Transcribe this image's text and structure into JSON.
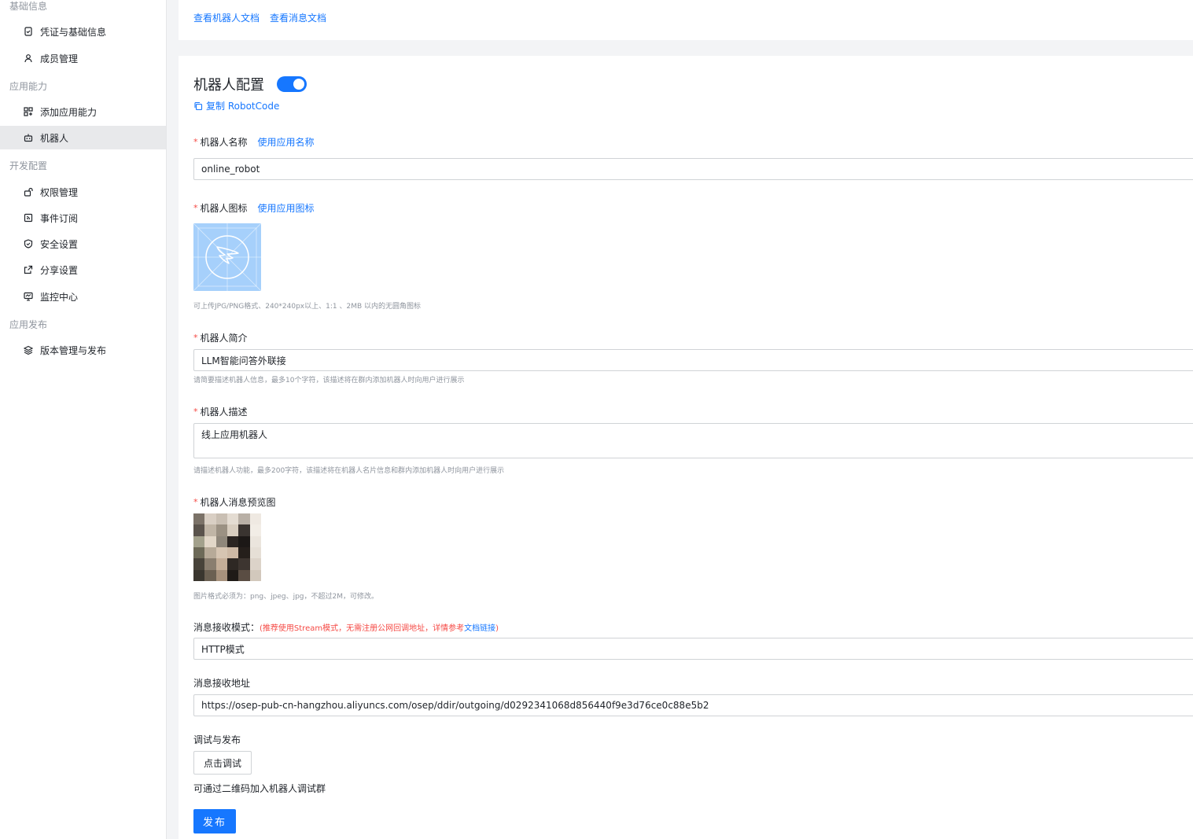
{
  "sidebar": {
    "groups": [
      {
        "title": "基础信息",
        "items": [
          {
            "label": "凭证与基础信息",
            "icon": "credential-icon"
          },
          {
            "label": "成员管理",
            "icon": "user-icon"
          }
        ]
      },
      {
        "title": "应用能力",
        "items": [
          {
            "label": "添加应用能力",
            "icon": "apps-icon"
          },
          {
            "label": "机器人",
            "icon": "robot-icon",
            "active": true
          }
        ]
      },
      {
        "title": "开发配置",
        "items": [
          {
            "label": "权限管理",
            "icon": "permission-icon"
          },
          {
            "label": "事件订阅",
            "icon": "subscribe-icon"
          },
          {
            "label": "安全设置",
            "icon": "shield-icon"
          },
          {
            "label": "分享设置",
            "icon": "share-icon"
          },
          {
            "label": "监控中心",
            "icon": "monitor-icon"
          }
        ]
      },
      {
        "title": "应用发布",
        "items": [
          {
            "label": "版本管理与发布",
            "icon": "layers-icon"
          }
        ]
      }
    ]
  },
  "top_links": {
    "robot_docs": "查看机器人文档",
    "message_docs": "查看消息文档"
  },
  "robot_config": {
    "title": "机器人配置",
    "enabled": true,
    "copy_label": "复制 RobotCode",
    "name": {
      "label": "机器人名称",
      "link": "使用应用名称",
      "value": "online_robot"
    },
    "icon": {
      "label": "机器人图标",
      "link": "使用应用图标",
      "hint": "可上传JPG/PNG格式、240*240px以上、1:1 、2MB 以内的无圆角图标"
    },
    "intro": {
      "label": "机器人简介",
      "value": "LLM智能问答外联接",
      "hint": "请简要描述机器人信息，最多10个字符，该描述将在群内添加机器人时向用户进行展示"
    },
    "description": {
      "label": "机器人描述",
      "value": "线上应用机器人",
      "hint": "请描述机器人功能，最多200字符，该描述将在机器人名片信息和群内添加机器人时向用户进行展示"
    },
    "preview": {
      "label": "机器人消息预览图",
      "hint": "图片格式必须为：png、jpeg、jpg，不超过2M，可修改。"
    },
    "receive_mode": {
      "label": "消息接收模式：",
      "note_prefix": "(推荐使用Stream模式，无需注册公网回调地址，详情参考",
      "note_link": "文档链接",
      "note_suffix": ")",
      "value": "HTTP模式"
    },
    "receive_url": {
      "label": "消息接收地址",
      "value": "https://osep-pub-cn-hangzhou.aliyuncs.com/osep/ddir/outgoing/d0292341068d856440f9e3d76ce0c88e5b2"
    },
    "debug": {
      "label": "调试与发布",
      "button": "点击调试",
      "qr_text": "可通过二维码加入机器人调试群"
    },
    "publish_button": "发布"
  },
  "colors": {
    "accent": "#1677ff",
    "required": "#f54a45",
    "icon_bg": "#a6d0fb",
    "active_nav": "#e8e9eb"
  }
}
